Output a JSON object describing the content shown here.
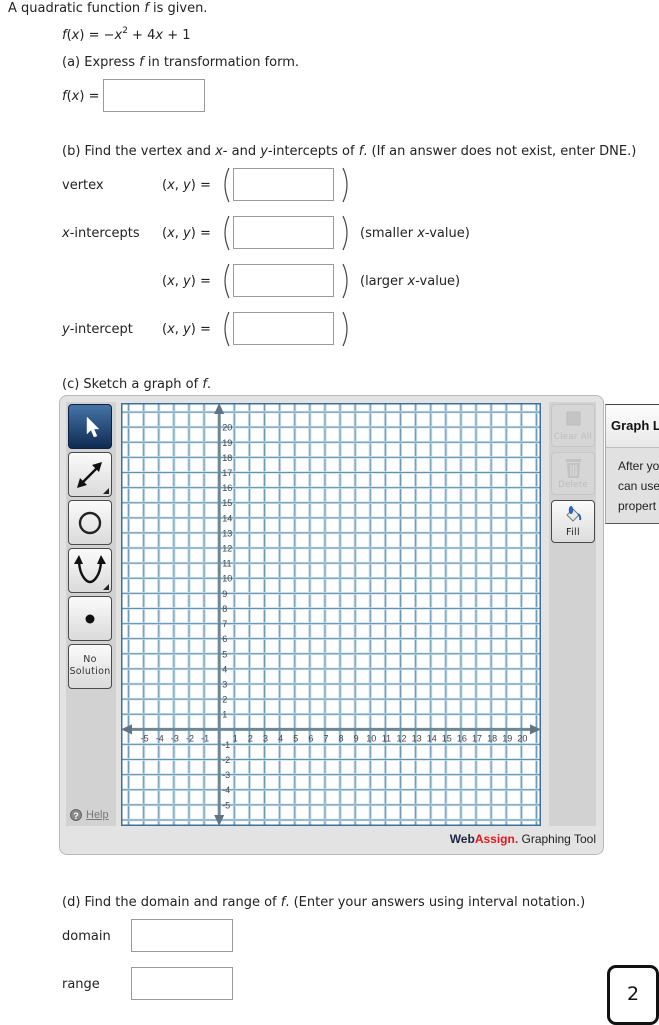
{
  "intro": {
    "before": "A quadratic function ",
    "f": "f",
    "after": " is given."
  },
  "equation": {
    "f": "f",
    "open": "(",
    "x": "x",
    "close_eq": ") = −",
    "x_sq": "x",
    "exp": "2",
    "mid": " + 4",
    "x_lin": "x",
    "end": " + 1"
  },
  "part_a": {
    "prompt_before": "(a) Express ",
    "prompt_f": "f",
    "prompt_after": " in transformation form.",
    "label_f": "f",
    "label_open": "(",
    "label_x": "x",
    "label_close": ") =",
    "input_value": ""
  },
  "part_b": {
    "prompt": [
      "(b) Find the vertex and ",
      "x",
      "- and ",
      "y",
      "-intercepts of ",
      "f",
      ". (If an answer does not exist, enter DNE.)"
    ],
    "coord_label": {
      "open": "(",
      "x": "x",
      "comma": ", ",
      "y": "y",
      "close": ") ="
    },
    "rows": [
      {
        "label": "vertex",
        "label_var": "",
        "value": "",
        "note": "",
        "note_var": "",
        "note_end": ""
      },
      {
        "label": "-intercepts",
        "label_var": "x",
        "value": "",
        "note": "(smaller ",
        "note_var": "x",
        "note_end": "-value)"
      },
      {
        "label": "",
        "label_var": "",
        "value": "",
        "note": "(larger ",
        "note_var": "x",
        "note_end": "-value)"
      },
      {
        "label": "-intercept",
        "label_var": "y",
        "value": "",
        "note": "",
        "note_var": "",
        "note_end": ""
      }
    ],
    "paren_open": "(",
    "paren_close": ")"
  },
  "part_c": {
    "prompt_before": "(c) Sketch a graph of ",
    "prompt_f": "f",
    "prompt_after": "."
  },
  "graph_tool": {
    "tools": [
      {
        "name": "select",
        "active": true
      },
      {
        "name": "line",
        "active": false
      },
      {
        "name": "circle",
        "active": false
      },
      {
        "name": "parabola",
        "active": false
      },
      {
        "name": "point",
        "active": false
      },
      {
        "name": "no-solution",
        "label_1": "No",
        "label_2": "Solution",
        "active": false
      }
    ],
    "help_icon": "?",
    "help_label": "Help",
    "actions": {
      "clear_all": "Clear All",
      "delete": "Delete",
      "fill": "Fill"
    },
    "brand": {
      "web": "Web",
      "assign": "Assign.",
      "tool": " Graphing Tool"
    },
    "layers": {
      "title": "Graph L",
      "lines": [
        "After yo",
        "can use",
        "propert"
      ]
    }
  },
  "graph": {
    "x_range": [
      -6.5,
      21.3
    ],
    "y_range": [
      -6.4,
      21.6
    ],
    "x_ticks": [
      -5,
      -4,
      -3,
      -2,
      -1,
      1,
      2,
      3,
      4,
      5,
      6,
      7,
      8,
      9,
      10,
      11,
      12,
      13,
      14,
      15,
      16,
      17,
      18,
      19,
      20
    ],
    "y_ticks": [
      20,
      19,
      18,
      17,
      16,
      15,
      14,
      13,
      12,
      11,
      10,
      9,
      8,
      7,
      6,
      5,
      4,
      3,
      2,
      1,
      -1,
      -2,
      -3,
      -4,
      -5
    ]
  },
  "part_d": {
    "prompt_before": "(d) Find the domain and range of ",
    "prompt_f": "f",
    "prompt_after": ". (Enter your answers using interval notation.)",
    "domain_label": "domain",
    "domain_value": "",
    "range_label": "range",
    "range_value": ""
  },
  "page_number": "2"
}
